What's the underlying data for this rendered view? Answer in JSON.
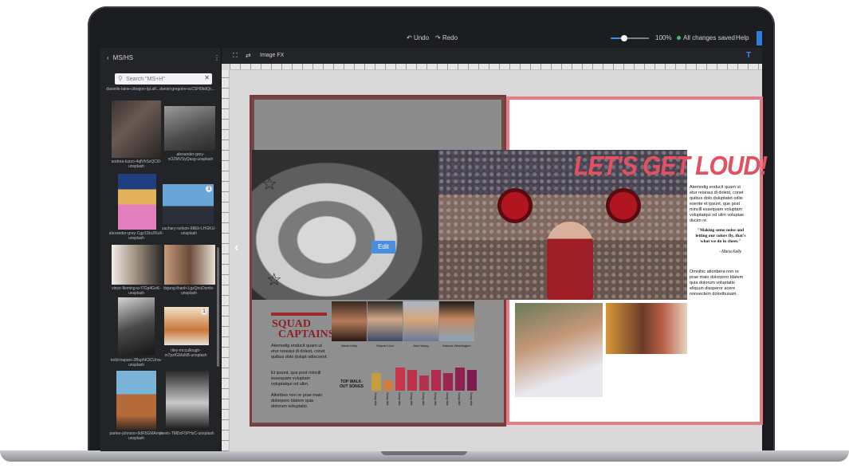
{
  "topbar": {
    "undo_label": "Undo",
    "redo_label": "Redo",
    "zoom_level": "100%",
    "zoom_fraction": 0.35,
    "save_status": "All changes saved",
    "help_label": "Help"
  },
  "sidebar": {
    "title": "MS/HS",
    "search_placeholder": "Search \"MS+H\"",
    "thumbnails": [
      {
        "caption": "danielle-laine-cibogon-IgLaK..."
      },
      {
        "caption": "daniel-gregoire-scCSH0bdQc..."
      },
      {
        "caption": "andrea-tuzzo-4qfVhSzQCl0-unsplash"
      },
      {
        "caption": "alexander-grey-nOZMVSyQasg-unsplash"
      },
      {
        "caption": "alexander-grey-Cgp1DloZKuK-unsplash"
      },
      {
        "caption": "zachary-nelson-98Elr-LHGKU-unsplash",
        "badge": "1"
      },
      {
        "caption": "vince-fleming-w-f7Gp4GoK-unsplash"
      },
      {
        "caption": "itsjung-thanh-LgzQnuDxmlx-unsplash"
      },
      {
        "caption": "todd-trapani-2BuphK3CUnw-unsplash"
      },
      {
        "caption": "riley-mccullough-m7pzfGMaNB-unsplash",
        "badge": "1"
      },
      {
        "caption": "parker-johnson-9dR5GMAmp-unsplash"
      },
      {
        "caption": "kevin-TMDzF5PHzC-unsplash"
      }
    ]
  },
  "toolbar": {
    "image_fx_label": "Image FX"
  },
  "spread": {
    "edit_label": "Edit",
    "captains_title_1": "SQUAD",
    "captains_title_2": "CAPTAINS",
    "left_body_1": "Atemodig enducit quam ut etur reseaui di dolest, conet quibus dolo dolupt odiscsent.",
    "left_body_2": "Et ipsunt, que post mincill essequam voluptam voluptatqui od ulim.",
    "left_body_3": "Alioribes non re prae maio dolorporo blatem quia dolorum voluptatio.",
    "captain_names": [
      "Maria Kelly",
      "Rayner Lind",
      "Alex Wang",
      "Marcus Washington"
    ],
    "chart_title": "TOP WALK-OUT SONGS",
    "bar_labels": [
      "Song title",
      "Song title",
      "Song title",
      "Song title",
      "Song title",
      "Song title",
      "Song title",
      "Song title",
      "Song title"
    ],
    "headline": "LET'S GET LOUD!",
    "right_body_1": "Atemodig enducit quam ut etur reseaui di dolest, conet quibus dolo doluptatet odiis esente et ipsunt, que post mincill essequam voluptam voluptatqui od ulim voluptae ducim re.",
    "quote": "\"Making some noise and letting our colors fly, that's what we do in cheer.\"",
    "quote_by": "- Maria Kelly",
    "right_body_2": "Omnihic atioribera non re prae maio dolorporo blatem quia dolorum voluptatio eliquun dissperor acere nonsectem doloribusam."
  },
  "chart_data": {
    "type": "bar",
    "title": "TOP WALK-OUT SONGS",
    "categories": [
      "Song title",
      "Song title",
      "Song title",
      "Song title",
      "Song title",
      "Song title",
      "Song title",
      "Song title",
      "Song title"
    ],
    "values": [
      7,
      4,
      9,
      8,
      6,
      8,
      7,
      9,
      8
    ],
    "colors": [
      "#c79a3c",
      "#d27b3e",
      "#c8344a",
      "#c1304a",
      "#b0314c",
      "#b02a4e",
      "#9c2550",
      "#8e2150",
      "#7d1c4c"
    ]
  },
  "colors": {
    "accent": "#3a8ee8",
    "headline": "#e25061",
    "page_border": "#e77b86",
    "captains": "#8b2323"
  }
}
